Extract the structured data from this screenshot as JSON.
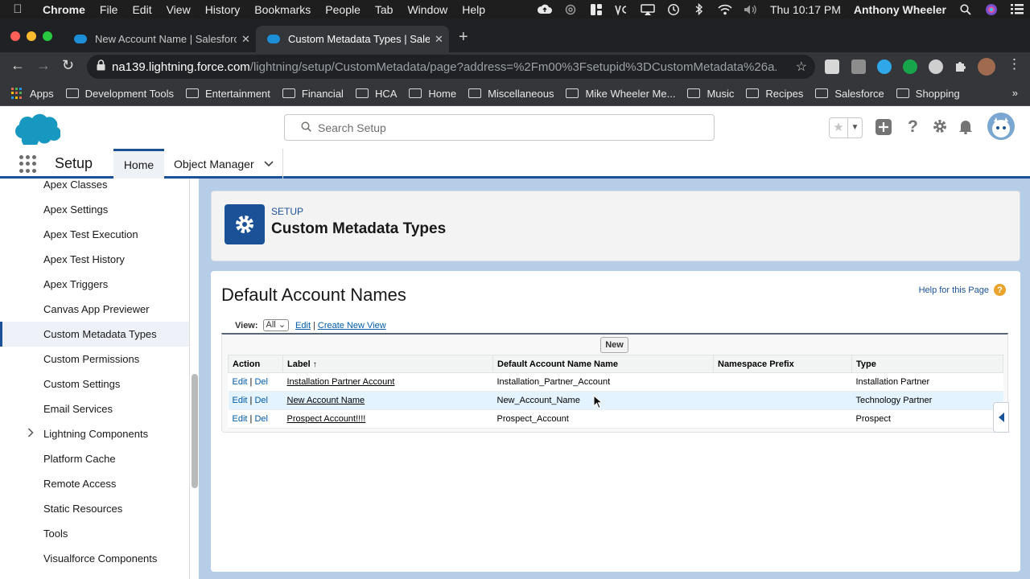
{
  "menubar": {
    "app": "Chrome",
    "items": [
      "File",
      "Edit",
      "View",
      "History",
      "Bookmarks",
      "People",
      "Tab",
      "Window",
      "Help"
    ],
    "clock": "Thu 10:17 PM",
    "user": "Anthony Wheeler"
  },
  "browser": {
    "tabs": [
      {
        "label": "New Account Name | Salesforce"
      },
      {
        "label": "Custom Metadata Types | Salesforce"
      }
    ],
    "url_host": "na139.lightning.force.com",
    "url_path": "/lightning/setup/CustomMetadata/page?address=%2Fm00%3Fsetupid%3DCustomMetadata%26a..."
  },
  "bookmarks": {
    "apps_label": "Apps",
    "items": [
      "Development Tools",
      "Entertainment",
      "Financial",
      "HCA",
      "Home",
      "Miscellaneous",
      "Mike Wheeler Me...",
      "Music",
      "Recipes",
      "Salesforce",
      "Shopping"
    ]
  },
  "sfheader": {
    "search_placeholder": "Search Setup"
  },
  "setupbar": {
    "title": "Setup",
    "home_tab": "Home",
    "object_manager_tab": "Object Manager"
  },
  "sidebar": {
    "items": [
      {
        "label": "Apex Classes"
      },
      {
        "label": "Apex Settings"
      },
      {
        "label": "Apex Test Execution"
      },
      {
        "label": "Apex Test History"
      },
      {
        "label": "Apex Triggers"
      },
      {
        "label": "Canvas App Previewer"
      },
      {
        "label": "Custom Metadata Types",
        "active": true
      },
      {
        "label": "Custom Permissions"
      },
      {
        "label": "Custom Settings"
      },
      {
        "label": "Email Services"
      },
      {
        "label": "Lightning Components",
        "expandable": true
      },
      {
        "label": "Platform Cache"
      },
      {
        "label": "Remote Access"
      },
      {
        "label": "Static Resources"
      },
      {
        "label": "Tools"
      },
      {
        "label": "Visualforce Components"
      }
    ]
  },
  "page": {
    "breadcrumb": "SETUP",
    "title": "Custom Metadata Types",
    "heading": "Default Account Names",
    "help_link": "Help for this Page",
    "view_label": "View:",
    "view_selected": "All",
    "edit_link": "Edit",
    "create_view_link": "Create New View",
    "new_button": "New"
  },
  "table": {
    "columns": [
      "Action",
      "Label",
      "Default Account Name Name",
      "Namespace Prefix",
      "Type"
    ],
    "sort_indicator": "↑",
    "rows": [
      {
        "edit": "Edit",
        "del": "Del",
        "label": "Installation Partner Account",
        "name": "Installation_Partner_Account",
        "namespace": "",
        "type": "Installation Partner"
      },
      {
        "edit": "Edit",
        "del": "Del",
        "label": "New Account Name",
        "name": "New_Account_Name",
        "namespace": "",
        "type": "Technology Partner"
      },
      {
        "edit": "Edit",
        "del": "Del",
        "label": "Prospect Account!!!!",
        "name": "Prospect_Account",
        "namespace": "",
        "type": "Prospect"
      }
    ]
  },
  "colors": {
    "sf_brand_blue": "#1b5297",
    "sf_cloud": "#1798c1",
    "content_background": "#b5cde6",
    "link_blue": "#015ba7",
    "help_orange": "#e9a22c"
  }
}
